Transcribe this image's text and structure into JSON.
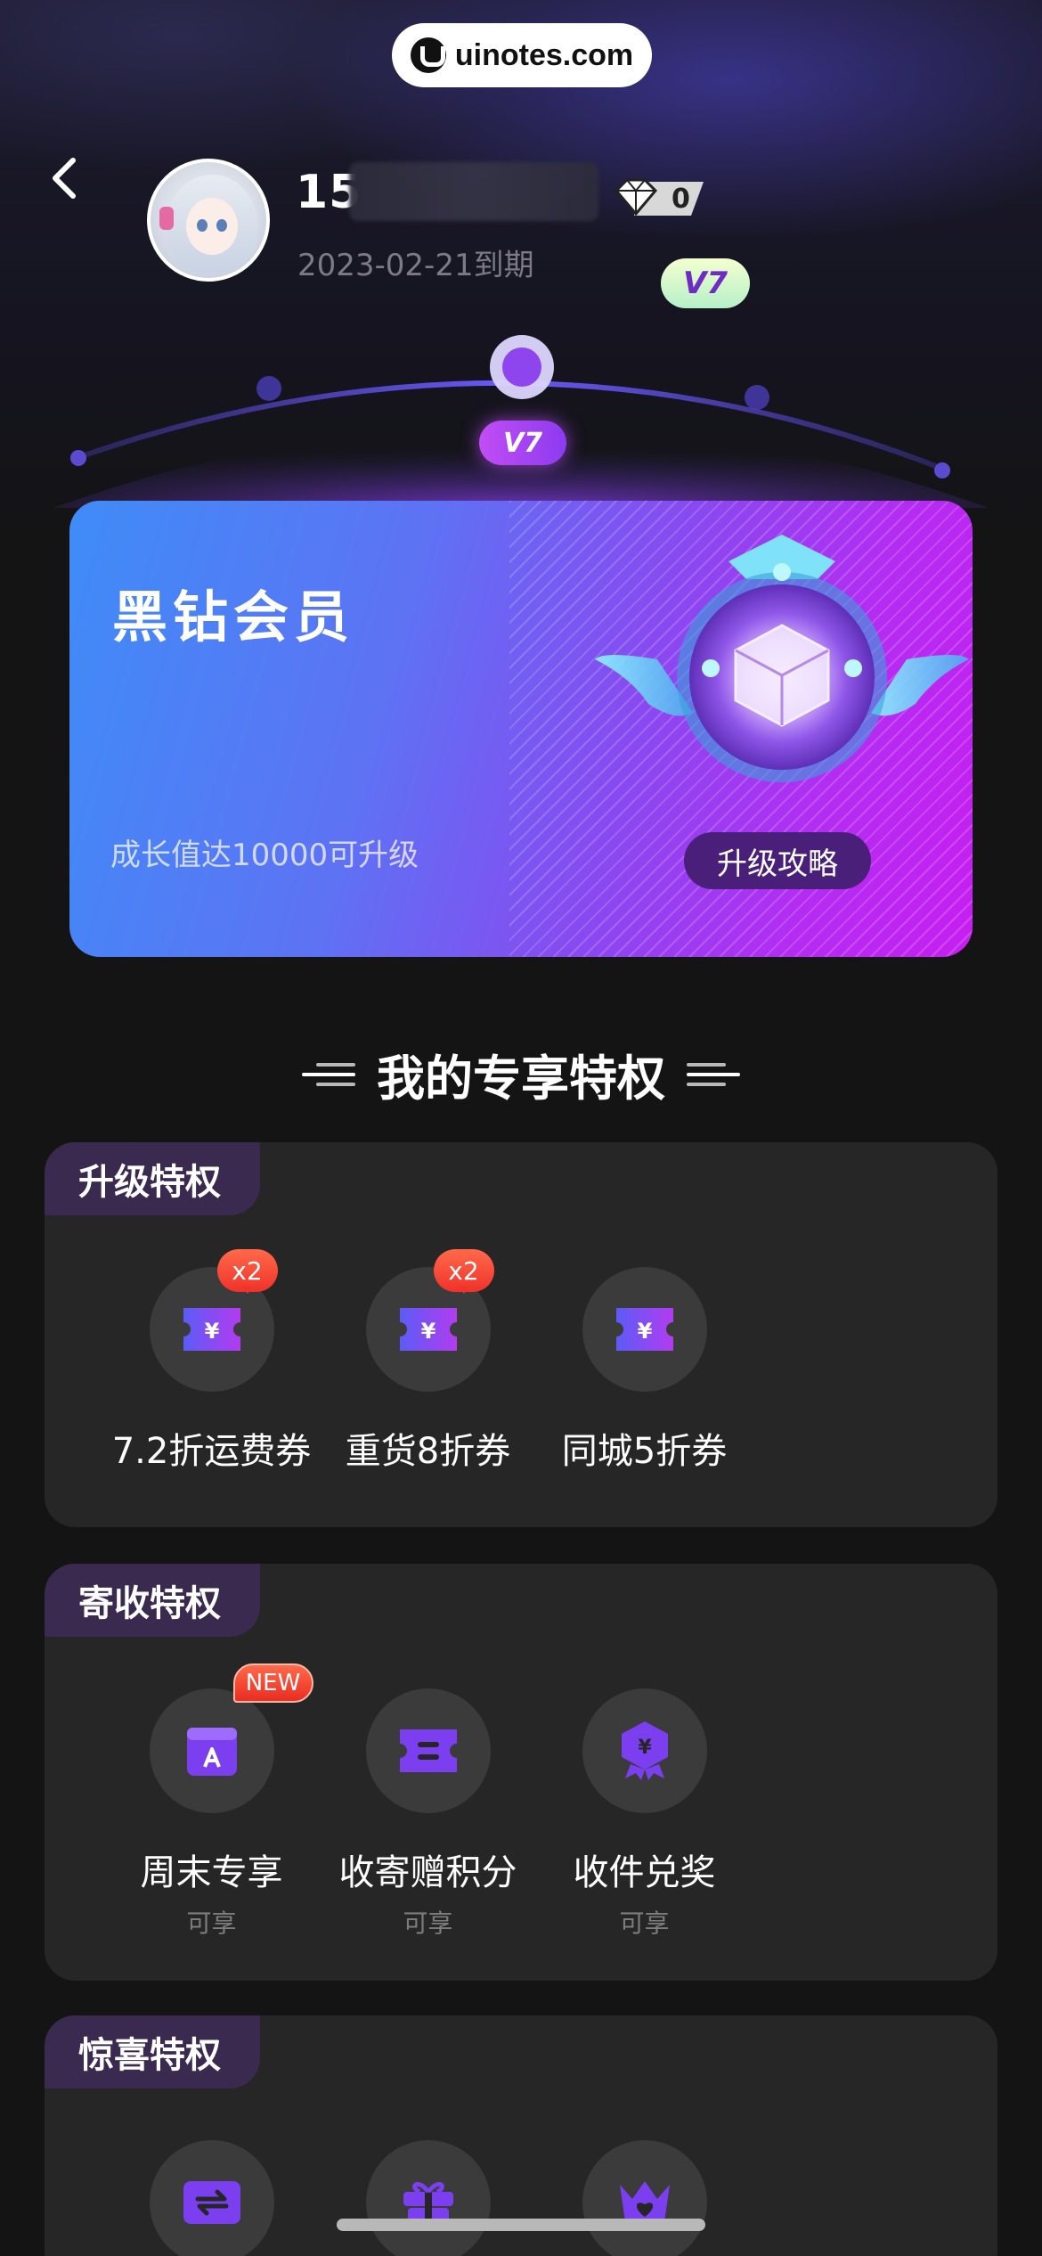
{
  "watermark": {
    "text": "uinotes.com"
  },
  "header": {
    "user_name_prefix": "15",
    "level_count": "0",
    "expire_text": "2023-02-21到期"
  },
  "level_track": {
    "current_level": "V7"
  },
  "member_card": {
    "title": "黑钻会员",
    "subtitle": "成长值达10000可升级",
    "upgrade_button": "升级攻略",
    "medal_level": "V7"
  },
  "section": {
    "title": "我的专享特权"
  },
  "panels": [
    {
      "tag": "升级特权",
      "items": [
        {
          "label": "7.2折运费券",
          "badge": "x2",
          "icon": "coupon-icon"
        },
        {
          "label": "重货8折券",
          "badge": "x2",
          "icon": "coupon-icon"
        },
        {
          "label": "同城5折券",
          "icon": "coupon-icon"
        }
      ]
    },
    {
      "tag": "寄收特权",
      "items": [
        {
          "label": "周末专享",
          "sub": "可享",
          "badge": "NEW",
          "icon": "calendar-icon"
        },
        {
          "label": "收寄赠积分",
          "sub": "可享",
          "icon": "points-ticket-icon"
        },
        {
          "label": "收件兑奖",
          "sub": "可享",
          "icon": "reward-badge-icon"
        }
      ]
    },
    {
      "tag": "惊喜特权",
      "items": [
        {
          "icon": "exchange-card-icon"
        },
        {
          "icon": "gift-icon"
        },
        {
          "icon": "crown-heart-icon"
        }
      ]
    }
  ],
  "colors": {
    "background": "#141414",
    "panel": "#262626",
    "panel_tag": "#3a2a4f",
    "icon_purple": "#7b3ff0",
    "badge_red": "#f0322a"
  }
}
